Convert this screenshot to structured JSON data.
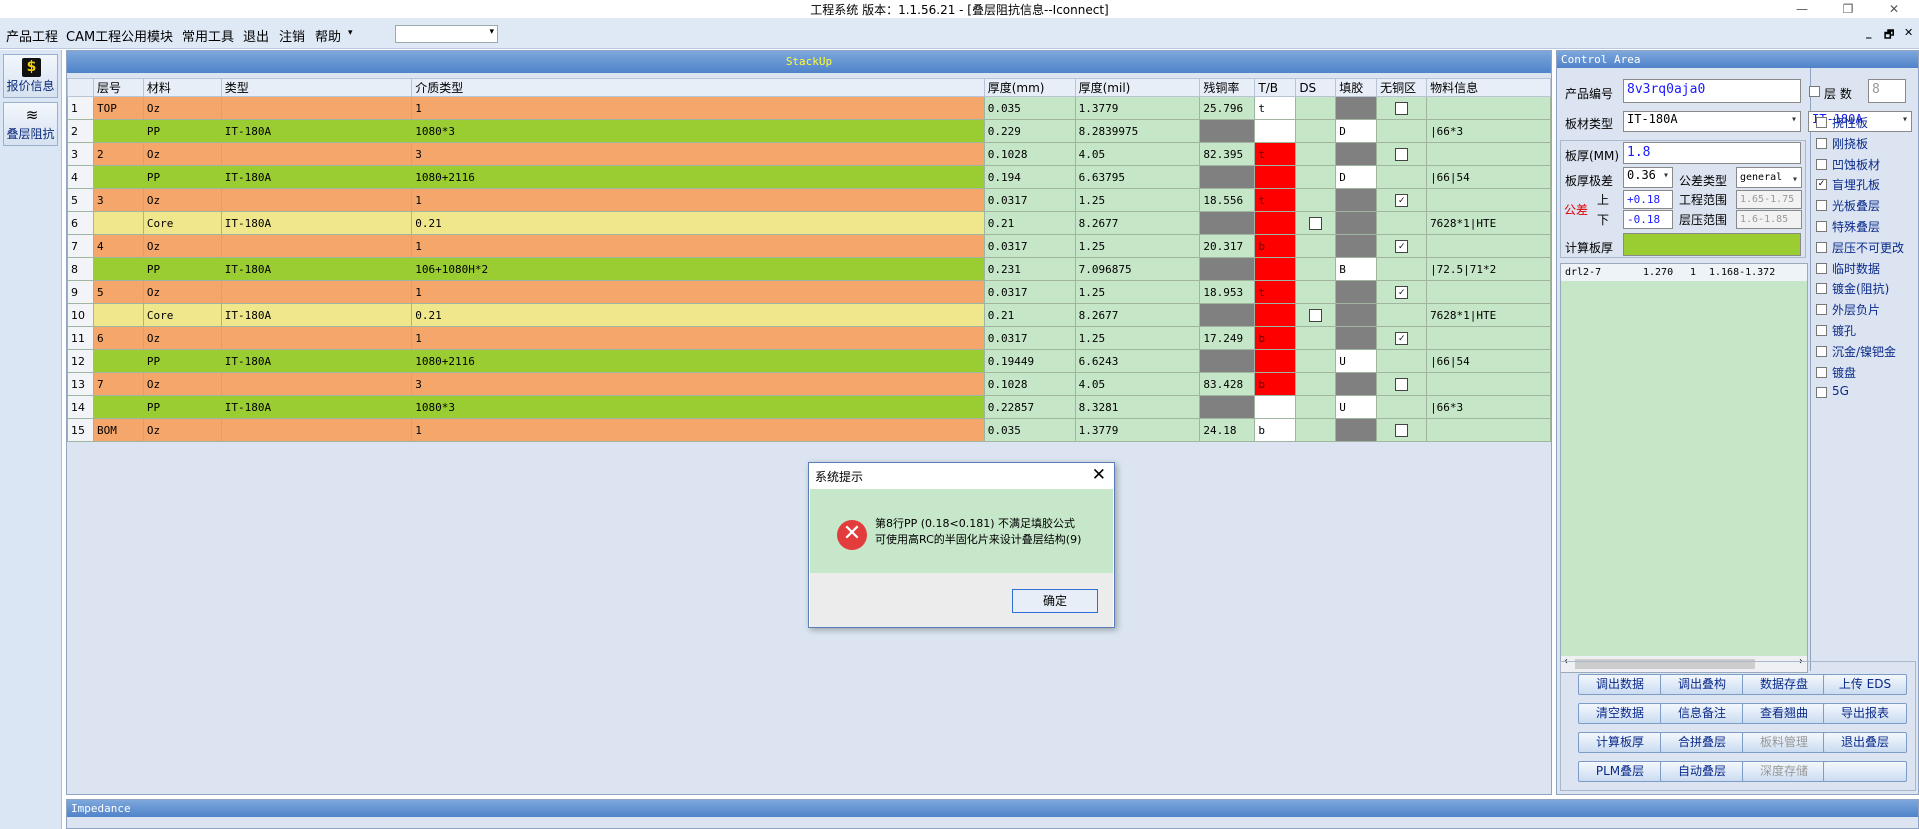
{
  "window": {
    "title": "工程系统   版本：1.1.56.21 - [叠层阻抗信息--Iconnect]"
  },
  "menu": {
    "items": [
      "产品工程",
      "CAM工程",
      "公用模块",
      "常用工具",
      "退出",
      "注销",
      "帮助"
    ],
    "arrow": "▾",
    "mdi_min": "_",
    "mdi_restore": "🗗",
    "mdi_close": "✕"
  },
  "winctl": {
    "min": "—",
    "max": "❐",
    "close": "✕"
  },
  "sidebar": {
    "quote_label": "报价信息",
    "stack_label": "叠层阻抗",
    "quote_icon": "$",
    "stack_icon": "≋"
  },
  "stackup": {
    "title": "StackUp",
    "columns": [
      "",
      "层号",
      "材料",
      "类型",
      "介质类型",
      "厚度(mm)",
      "厚度(mil)",
      "残铜率",
      "T/B",
      "DS",
      "填胶",
      "无铜区",
      "物料信息"
    ],
    "rows": [
      {
        "n": "1",
        "layer": "TOP",
        "mat": "Oz",
        "type": "",
        "diel": "1",
        "mm": "0.035",
        "mil": "1.3779",
        "cu": "25.796",
        "tb": "t",
        "ds": "",
        "fill": "gray",
        "nocu": "box",
        "info": "",
        "color": "#f5a76b"
      },
      {
        "n": "2",
        "layer": "",
        "mat": "PP",
        "type": "IT-180A",
        "diel": "1080*3",
        "mm": "0.229",
        "mil": "8.2839975",
        "cu": "gray",
        "tb": "white",
        "ds": "",
        "fill": "D",
        "nocu": "",
        "info": "|66*3",
        "color": "#9acd32"
      },
      {
        "n": "3",
        "layer": "2",
        "mat": "Oz",
        "type": "",
        "diel": "3",
        "mm": "0.1028",
        "mil": "4.05",
        "cu": "82.395",
        "tb": "red:t",
        "ds": "",
        "fill": "gray",
        "nocu": "box",
        "info": "",
        "color": "#f5a76b"
      },
      {
        "n": "4",
        "layer": "",
        "mat": "PP",
        "type": "IT-180A",
        "diel": "1080+2116",
        "mm": "0.194",
        "mil": "6.63795",
        "cu": "gray",
        "tb": "red",
        "ds": "",
        "fill": "D",
        "nocu": "",
        "info": "|66|54",
        "color": "#9acd32"
      },
      {
        "n": "5",
        "layer": "3",
        "mat": "Oz",
        "type": "",
        "diel": "1",
        "mm": "0.0317",
        "mil": "1.25",
        "cu": "18.556",
        "tb": "red:t",
        "ds": "",
        "fill": "gray",
        "nocu": "check",
        "info": "",
        "color": "#f5a76b"
      },
      {
        "n": "6",
        "layer": "",
        "mat": "Core",
        "type": "IT-180A",
        "diel": "0.21",
        "mm": "0.21",
        "mil": "8.2677",
        "cu": "gray",
        "tb": "red",
        "ds": "box",
        "fill": "gray",
        "nocu": "",
        "info": "7628*1|HTE",
        "color": "#f0e68c"
      },
      {
        "n": "7",
        "layer": "4",
        "mat": "Oz",
        "type": "",
        "diel": "1",
        "mm": "0.0317",
        "mil": "1.25",
        "cu": "20.317",
        "tb": "red:b",
        "ds": "",
        "fill": "gray",
        "nocu": "check",
        "info": "",
        "color": "#f5a76b"
      },
      {
        "n": "8",
        "layer": "",
        "mat": "PP",
        "type": "IT-180A",
        "diel": "106+1080H*2",
        "mm": "0.231",
        "mil": "7.096875",
        "cu": "gray",
        "tb": "red",
        "ds": "",
        "fill": "B",
        "nocu": "",
        "info": "|72.5|71*2",
        "color": "#9acd32"
      },
      {
        "n": "9",
        "layer": "5",
        "mat": "Oz",
        "type": "",
        "diel": "1",
        "mm": "0.0317",
        "mil": "1.25",
        "cu": "18.953",
        "tb": "red:t",
        "ds": "",
        "fill": "gray",
        "nocu": "check",
        "info": "",
        "color": "#f5a76b"
      },
      {
        "n": "10",
        "layer": "",
        "mat": "Core",
        "type": "IT-180A",
        "diel": "0.21",
        "mm": "0.21",
        "mil": "8.2677",
        "cu": "gray",
        "tb": "red",
        "ds": "box",
        "fill": "gray",
        "nocu": "",
        "info": "7628*1|HTE",
        "color": "#f0e68c"
      },
      {
        "n": "11",
        "layer": "6",
        "mat": "Oz",
        "type": "",
        "diel": "1",
        "mm": "0.0317",
        "mil": "1.25",
        "cu": "17.249",
        "tb": "red:b",
        "ds": "",
        "fill": "gray",
        "nocu": "check",
        "info": "",
        "color": "#f5a76b"
      },
      {
        "n": "12",
        "layer": "",
        "mat": "PP",
        "type": "IT-180A",
        "diel": "1080+2116",
        "mm": "0.19449",
        "mil": "6.6243",
        "cu": "gray",
        "tb": "red",
        "ds": "",
        "fill": "U",
        "nocu": "",
        "info": "|66|54",
        "color": "#9acd32"
      },
      {
        "n": "13",
        "layer": "7",
        "mat": "Oz",
        "type": "",
        "diel": "3",
        "mm": "0.1028",
        "mil": "4.05",
        "cu": "83.428",
        "tb": "red:b",
        "ds": "",
        "fill": "gray",
        "nocu": "box",
        "info": "",
        "color": "#f5a76b"
      },
      {
        "n": "14",
        "layer": "",
        "mat": "PP",
        "type": "IT-180A",
        "diel": "1080*3",
        "mm": "0.22857",
        "mil": "8.3281",
        "cu": "gray",
        "tb": "white",
        "ds": "",
        "fill": "U",
        "nocu": "",
        "info": "|66*3",
        "color": "#9acd32"
      },
      {
        "n": "15",
        "layer": "BOM",
        "mat": "Oz",
        "type": "",
        "diel": "1",
        "mm": "0.035",
        "mil": "1.3779",
        "cu": "24.18",
        "tb": "b",
        "ds": "",
        "fill": "gray",
        "nocu": "box",
        "info": "",
        "color": "#f5a76b"
      }
    ]
  },
  "impedance": {
    "title": "Impedance"
  },
  "control": {
    "title": "Control Area",
    "product_label": "产品编号",
    "product_value": "8v3rq0aja0",
    "layers_label": "层 数",
    "layers_value": "8",
    "material_label": "板材类型",
    "material_value": "IT-180A",
    "material_value2": "IT-180A",
    "thickness_label": "板厚(MM)",
    "thickness_value": "1.8",
    "tolerance_label": "板厚极差",
    "tolerance_value": "0.36",
    "tol_type_label": "公差类型",
    "tol_type_value": "general",
    "tol_label": "公差",
    "up_label": "上",
    "down_label": "下",
    "up_value": "+0.18",
    "down_value": "-0.18",
    "eng_range_label": "工程范围",
    "eng_range_value": "1.65-1.75",
    "press_range_label": "层压范围",
    "press_range_value": "1.6-1.85",
    "calc_label": "计算板厚",
    "drill": {
      "name": "drl2-7",
      "v1": "1.270",
      "v2": "1",
      "v3": "1.168-1.372"
    },
    "options": [
      {
        "label": "挠性板",
        "checked": false
      },
      {
        "label": "刚挠板",
        "checked": false
      },
      {
        "label": "凹蚀板材",
        "checked": false
      },
      {
        "label": "盲埋孔板",
        "checked": true
      },
      {
        "label": "光板叠层",
        "checked": false
      },
      {
        "label": "特殊叠层",
        "checked": false
      },
      {
        "label": "层压不可更改",
        "checked": false
      },
      {
        "label": "临时数据",
        "checked": false
      },
      {
        "label": "镀金(阻抗)",
        "checked": false
      },
      {
        "label": "外层负片",
        "checked": false
      },
      {
        "label": "镀孔",
        "checked": false
      },
      {
        "label": "沉金/镍钯金",
        "checked": false
      },
      {
        "label": "镀盘",
        "checked": false
      },
      {
        "label": "5G",
        "checked": false
      }
    ],
    "buttons": [
      [
        "调出数据",
        "调出叠构",
        "数据存盘",
        "上传 EDS"
      ],
      [
        "清空数据",
        "信息备注",
        "查看翘曲",
        "导出报表"
      ],
      [
        "计算板厚",
        "合拼叠层",
        "板料管理",
        "退出叠层"
      ],
      [
        "PLM叠层",
        "自动叠层",
        "深度存储",
        ""
      ]
    ],
    "disabled_buttons": [
      "板料管理",
      "深度存储"
    ]
  },
  "dialog": {
    "title": "系统提示",
    "line1": "第8行PP (0.18<0.181) 不满足填胶公式",
    "line2": "可使用高RC的半固化片来设计叠层结构(9)",
    "ok": "确定",
    "close_icon": "✕",
    "error_icon": "✕"
  }
}
